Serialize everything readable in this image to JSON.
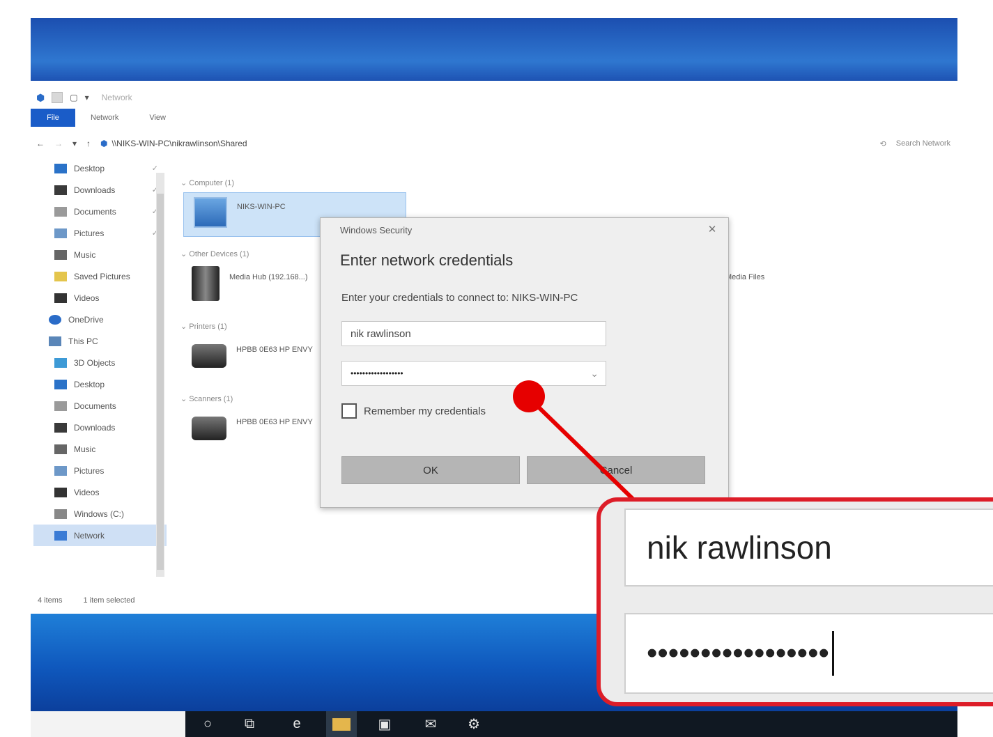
{
  "explorer": {
    "window_title": "Network",
    "ribbon_tabs": [
      "File",
      "Network",
      "View"
    ],
    "address_path": "\\\\NIKS-WIN-PC\\nikrawlinson\\Shared",
    "search_placeholder": "Search Network",
    "nav_items": [
      {
        "label": "Desktop",
        "icon": "desktop-icon",
        "pinned": true
      },
      {
        "label": "Downloads",
        "icon": "downloads-icon",
        "pinned": true
      },
      {
        "label": "Documents",
        "icon": "documents-icon",
        "pinned": true
      },
      {
        "label": "Pictures",
        "icon": "pictures-icon",
        "pinned": true
      },
      {
        "label": "Music",
        "icon": "music-icon",
        "pinned": false
      },
      {
        "label": "Saved Pictures",
        "icon": "saved-pictures-icon",
        "pinned": false
      },
      {
        "label": "Videos",
        "icon": "videos-icon",
        "pinned": false
      },
      {
        "label": "OneDrive",
        "icon": "onedrive-icon",
        "pinned": false
      },
      {
        "label": "This PC",
        "icon": "this-pc-icon",
        "pinned": false
      },
      {
        "label": "3D Objects",
        "icon": "3d-objects-icon",
        "pinned": false
      },
      {
        "label": "Desktop",
        "icon": "desktop-icon",
        "pinned": false
      },
      {
        "label": "Documents",
        "icon": "documents-icon",
        "pinned": false
      },
      {
        "label": "Downloads",
        "icon": "downloads-icon",
        "pinned": false
      },
      {
        "label": "Music",
        "icon": "music-icon",
        "pinned": false
      },
      {
        "label": "Pictures",
        "icon": "pictures-icon",
        "pinned": false
      },
      {
        "label": "Videos",
        "icon": "videos-icon",
        "pinned": false
      },
      {
        "label": "Windows (C:)",
        "icon": "drive-icon",
        "pinned": false
      },
      {
        "label": "Network",
        "icon": "network-icon",
        "pinned": false
      }
    ],
    "groups": {
      "computer": "Computer (1)",
      "other": "Other Devices (1)",
      "printers": "Printers (1)",
      "scanners": "Scanners (1)"
    },
    "items": {
      "computer": "NIKS-WIN-PC",
      "other": "Media Hub (192.168...)",
      "other_right": "Media Files",
      "printer": "HPBB 0E63 HP ENVY",
      "scanner": "HPBB 0E63 HP ENVY"
    },
    "status": {
      "items": "4 items",
      "selected": "1 item selected"
    }
  },
  "dialog": {
    "window_title": "Windows Security",
    "heading": "Enter network credentials",
    "prompt": "Enter your credentials to connect to: NIKS-WIN-PC",
    "username": "nik rawlinson",
    "password_mask": "••••••••••••••••••",
    "remember_label": "Remember my credentials",
    "ok_label": "OK",
    "cancel_label": "Cancel"
  },
  "zoom": {
    "username": "nik rawlinson",
    "password_mask": "•••••••••••••••••"
  },
  "colors": {
    "accent": "#1a5cc8",
    "callout_red": "#dd1d28"
  }
}
